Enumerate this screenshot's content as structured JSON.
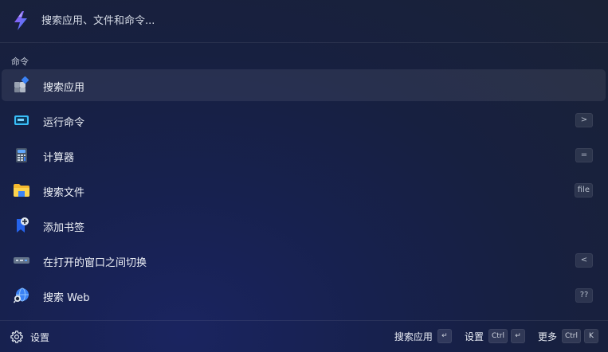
{
  "search": {
    "placeholder": "搜索应用、文件和命令..."
  },
  "section": {
    "label": "命令"
  },
  "items": [
    {
      "label": "搜索应用",
      "shortcut": "",
      "icon": "apps-icon",
      "selected": true
    },
    {
      "label": "运行命令",
      "shortcut": ">",
      "icon": "terminal-icon",
      "selected": false
    },
    {
      "label": "计算器",
      "shortcut": "=",
      "icon": "calculator-icon",
      "selected": false
    },
    {
      "label": "搜索文件",
      "shortcut": "file",
      "icon": "folder-icon",
      "selected": false
    },
    {
      "label": "添加书签",
      "shortcut": "",
      "icon": "bookmark-add-icon",
      "selected": false
    },
    {
      "label": "在打开的窗口之间切换",
      "shortcut": "<",
      "icon": "window-switch-icon",
      "selected": false
    },
    {
      "label": "搜索 Web",
      "shortcut": "??",
      "icon": "web-search-icon",
      "selected": false
    }
  ],
  "footer": {
    "settings_label": "设置",
    "actions": {
      "search_apps": {
        "label": "搜索应用",
        "keys": [
          "↵"
        ]
      },
      "settings": {
        "label": "设置",
        "keys": [
          "Ctrl",
          "↵"
        ]
      },
      "more": {
        "label": "更多",
        "keys": [
          "Ctrl",
          "K"
        ]
      }
    }
  },
  "colors": {
    "background": "#172040",
    "selected_row": "#2a3350",
    "accent_purple": "#8b5cf6",
    "accent_blue": "#3b82f6"
  }
}
